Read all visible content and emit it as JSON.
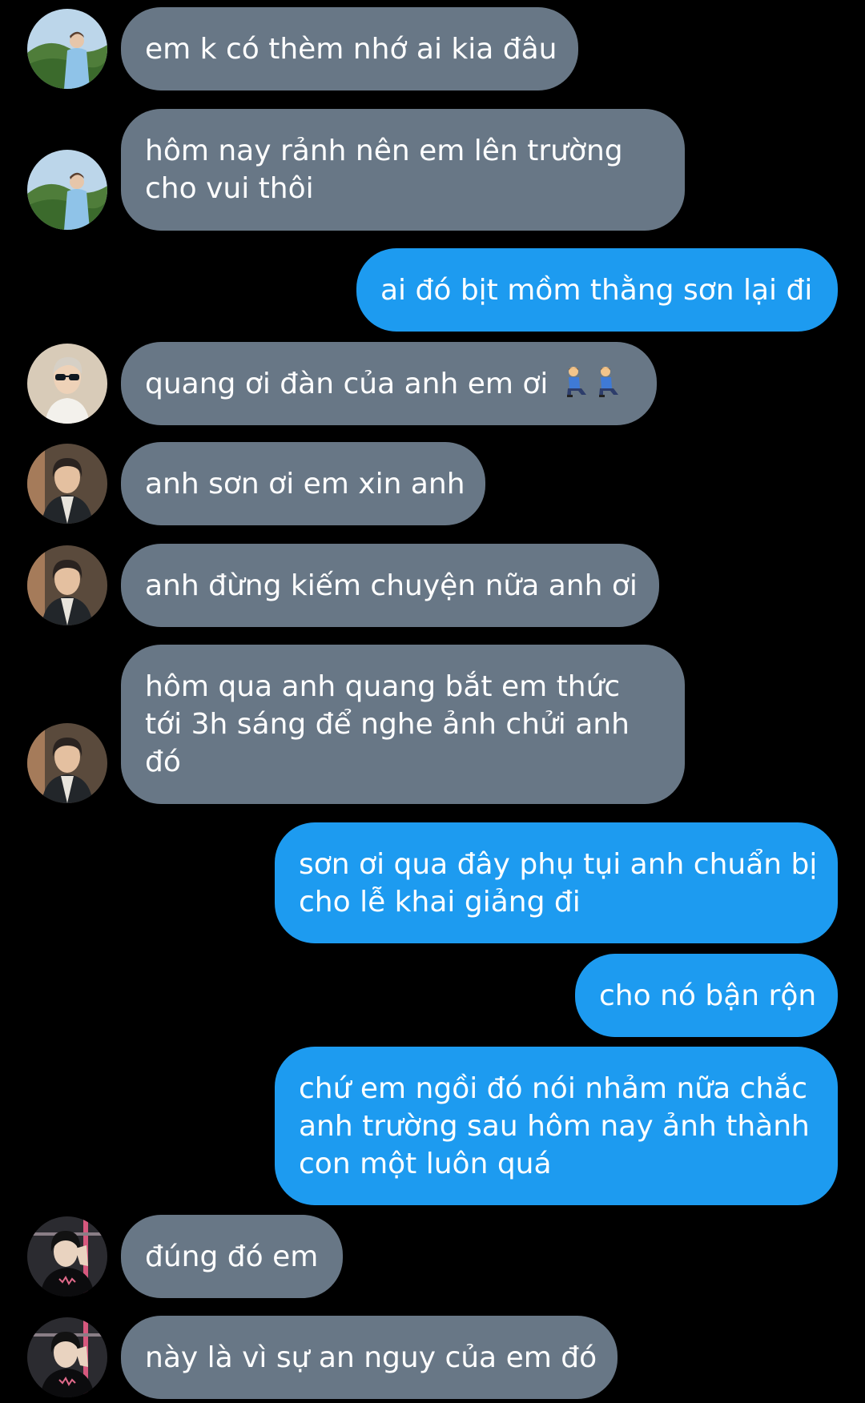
{
  "colors": {
    "background": "#000000",
    "incoming_bubble": "#687786",
    "outgoing_bubble": "#1d9bf0",
    "text": "#ffffff"
  },
  "messages": [
    {
      "direction": "incoming",
      "avatar": "avatar-landscape",
      "lines": [
        "em k có thèm nhớ ai kia đâu"
      ]
    },
    {
      "direction": "incoming",
      "avatar": "avatar-landscape",
      "lines": [
        "hôm nay rảnh nên em lên trường",
        "cho vui thôi"
      ]
    },
    {
      "direction": "outgoing",
      "lines": [
        "ai đó bịt mồm thằng sơn lại đi"
      ]
    },
    {
      "direction": "incoming",
      "avatar": "avatar-sunglasses",
      "lines": [
        "quang ơi đàn của anh em ơi"
      ],
      "emoji": [
        "person-kneeling-emoji",
        "person-kneeling-emoji"
      ]
    },
    {
      "direction": "incoming",
      "avatar": "avatar-indoor",
      "lines": [
        "anh sơn ơi em xin anh"
      ]
    },
    {
      "direction": "incoming",
      "avatar": "avatar-indoor",
      "lines": [
        "anh đừng kiếm chuyện nữa anh ơi"
      ]
    },
    {
      "direction": "incoming",
      "avatar": "avatar-indoor",
      "lines": [
        "hôm qua anh quang bắt em thức",
        "tới 3h sáng để nghe ảnh chửi anh",
        "đó"
      ]
    },
    {
      "direction": "outgoing",
      "lines": [
        "sơn ơi qua đây phụ tụi anh chuẩn bị",
        "cho lễ khai giảng đi"
      ]
    },
    {
      "direction": "outgoing",
      "lines": [
        "cho nó bận rộn"
      ]
    },
    {
      "direction": "outgoing",
      "lines": [
        "chứ em ngồi đó nói nhảm nữa chắc",
        "anh trường sau hôm nay ảnh thành",
        "con một luôn quá"
      ]
    },
    {
      "direction": "incoming",
      "avatar": "avatar-dark-pose",
      "lines": [
        "đúng đó em"
      ]
    },
    {
      "direction": "incoming",
      "avatar": "avatar-dark-pose",
      "lines": [
        "này là vì sự an nguy của em đó"
      ]
    }
  ]
}
